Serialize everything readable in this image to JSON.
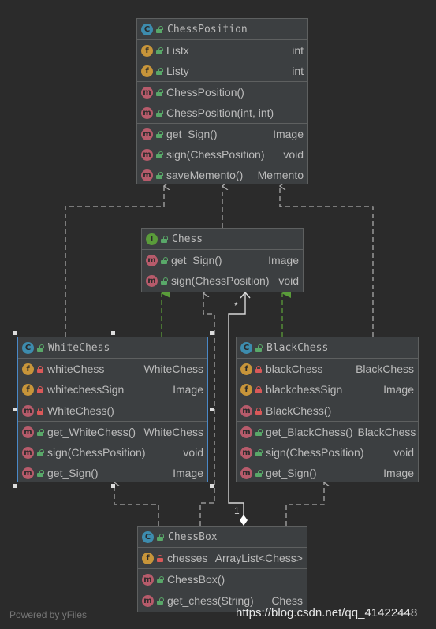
{
  "classes": {
    "chessposition": {
      "kind": "C",
      "name": "ChessPosition",
      "fields": [
        {
          "name": "Listx",
          "type": "int"
        },
        {
          "name": "Listy",
          "type": "int"
        }
      ],
      "constructors": [
        {
          "name": "ChessPosition()",
          "type": ""
        },
        {
          "name": "ChessPosition(int, int)",
          "type": ""
        }
      ],
      "methods": [
        {
          "name": "get_Sign()",
          "type": "Image"
        },
        {
          "name": "sign(ChessPosition)",
          "type": "void"
        },
        {
          "name": "saveMemento()",
          "type": "Memento"
        }
      ]
    },
    "chess": {
      "kind": "I",
      "name": "Chess",
      "methods": [
        {
          "name": "get_Sign()",
          "type": "Image"
        },
        {
          "name": "sign(ChessPosition)",
          "type": "void"
        }
      ]
    },
    "whitechess": {
      "kind": "C",
      "name": "WhiteChess",
      "fields": [
        {
          "name": "whiteChess",
          "type": "WhiteChess"
        },
        {
          "name": "whitechessSign",
          "type": "Image"
        }
      ],
      "constructors": [
        {
          "name": "WhiteChess()",
          "type": ""
        }
      ],
      "methods": [
        {
          "name": "get_WhiteChess()",
          "type": "WhiteChess"
        },
        {
          "name": "sign(ChessPosition)",
          "type": "void"
        },
        {
          "name": "get_Sign()",
          "type": "Image"
        }
      ]
    },
    "blackchess": {
      "kind": "C",
      "name": "BlackChess",
      "fields": [
        {
          "name": "blackChess",
          "type": "BlackChess"
        },
        {
          "name": "blackchessSign",
          "type": "Image"
        }
      ],
      "constructors": [
        {
          "name": "BlackChess()",
          "type": ""
        }
      ],
      "methods": [
        {
          "name": "get_BlackChess()",
          "type": "BlackChess"
        },
        {
          "name": "sign(ChessPosition)",
          "type": "void"
        },
        {
          "name": "get_Sign()",
          "type": "Image"
        }
      ]
    },
    "chessbox": {
      "kind": "C",
      "name": "ChessBox",
      "fields": [
        {
          "name": "chesses",
          "type": "ArrayList<Chess>"
        }
      ],
      "constructors": [
        {
          "name": "ChessBox()",
          "type": ""
        }
      ],
      "methods": [
        {
          "name": "get_chess(String)",
          "type": "Chess"
        }
      ]
    }
  },
  "multiplicity": {
    "many": "*",
    "one": "1"
  },
  "footer": "Powered by yFiles",
  "watermark": "https://blog.csdn.net/qq_41422448",
  "colors": {
    "background": "#2b2b2b",
    "box": "#3c3f41",
    "border": "#5e6060",
    "text": "#bbbbbb",
    "edge": "#a9a9a9",
    "realization": "#5a9c3a",
    "selection": "#4a88c7"
  }
}
